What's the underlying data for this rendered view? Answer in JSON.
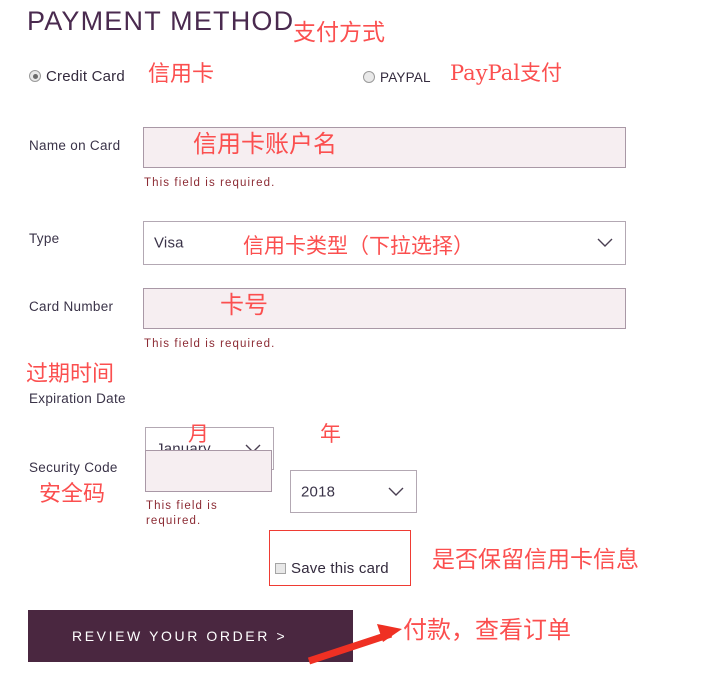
{
  "heading": {
    "title": "PAYMENT METHOD",
    "annotation": "支付方式"
  },
  "payment_options": {
    "credit_card": {
      "label": "Credit Card",
      "annotation": "信用卡",
      "selected": true
    },
    "paypal": {
      "label": "PAYPAL",
      "annotation": "PayPal支付",
      "selected": false
    }
  },
  "fields": {
    "name_on_card": {
      "label": "Name on Card",
      "value": "",
      "annotation": "信用卡账户名",
      "error": "This field is required."
    },
    "type": {
      "label": "Type",
      "value": "Visa",
      "annotation": "信用卡类型（下拉选择）"
    },
    "card_number": {
      "label": "Card Number",
      "value": "",
      "annotation": "卡号",
      "error": "This field is required."
    },
    "expiration": {
      "label": "Expiration Date",
      "annotation": "过期时间",
      "month": {
        "value": "January",
        "annotation": "月"
      },
      "year": {
        "value": "2018",
        "annotation": "年"
      }
    },
    "security_code": {
      "label": "Security Code",
      "value": "",
      "annotation": "安全码",
      "error": "This field is required."
    },
    "save_card": {
      "label": "Save this card",
      "checked": false,
      "annotation": "是否保留信用卡信息"
    }
  },
  "submit": {
    "label": "REVIEW YOUR ORDER >",
    "annotation": "付款，查看订单"
  },
  "colors": {
    "title": "#4a2a4f",
    "annotation_red": "#fb4f4f",
    "error_red": "#8c2b34",
    "button_bg": "#4a2740",
    "input_bg": "#f6eef1",
    "input_border": "#a998a6",
    "highlight_box": "#ef3b33"
  }
}
